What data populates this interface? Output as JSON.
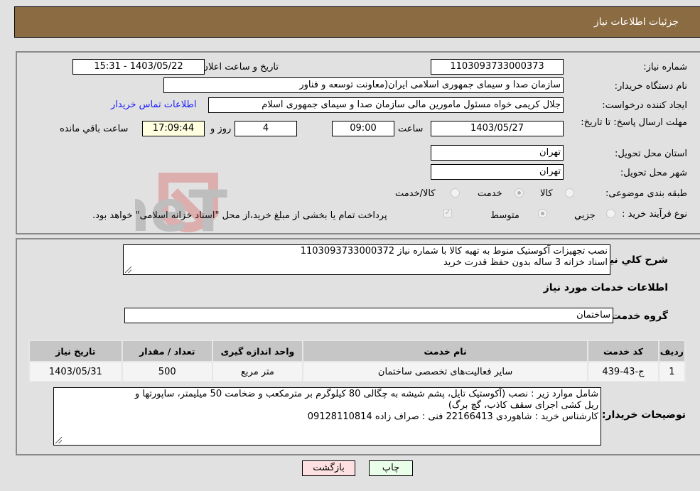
{
  "header": {
    "title": "جزئیات اطلاعات نیاز"
  },
  "form": {
    "need_number_label": "شماره نیاز:",
    "need_number": "1103093733000373",
    "announce_label": "تاریخ و ساعت اعلان عمومی:",
    "announce_value": "1403/05/22 - 15:31",
    "buyer_org_label": "نام دستگاه خریدار:",
    "buyer_org": "سازمان صدا و سیمای جمهوری اسلامی ایران(معاونت توسعه و فناور",
    "creator_label": "ایجاد کننده درخواست:",
    "creator": "جلال کریمی خواه مسئول مامورین مالی  سازمان صدا و سیمای جمهوری اسلام",
    "contact_link": "اطلاعات تماس خریدار",
    "deadline_label": "مهلت ارسال پاسخ: تا تاریخ:",
    "deadline_date": "1403/05/27",
    "time_label": "ساعت",
    "deadline_time": "09:00",
    "days_value": "4",
    "days_label": "روز و",
    "remaining_time": "17:09:44",
    "remaining_label": "ساعت باقي مانده",
    "province_label": "استان محل تحویل:",
    "province": "تهران",
    "city_label": "شهر محل تحویل:",
    "city": "تهران",
    "category_label": "طبقه بندی موضوعی:",
    "category_options": [
      {
        "label": "کالا",
        "checked": false
      },
      {
        "label": "خدمت",
        "checked": true
      },
      {
        "label": "کالا/خدمت",
        "checked": false
      }
    ],
    "process_label": "نوع فرآیند خرید :",
    "process_options": [
      {
        "label": "جزيي",
        "checked": false
      },
      {
        "label": "متوسط",
        "checked": true
      }
    ],
    "treasury_note": "پرداخت تمام یا بخشی از مبلغ خرید،از محل \"اسناد خزانه اسلامی\" خواهد بود.",
    "treasury_checked": true
  },
  "details": {
    "description_label": "شرح کلي نیاز:",
    "description_line1": "نصب تجهیزات آکوستیک  منوط به تهیه کالا با شماره نیاز 1103093733000372",
    "description_line2": "اسناد خزانه 3 ساله بدون حفظ قدرت خرید",
    "services_heading": "اطلاعات خدمات مورد نیاز",
    "service_group_label": "گروه خدمت:",
    "service_group": "ساختمان",
    "table": {
      "headers": [
        "ردیف",
        "کد خدمت",
        "نام خدمت",
        "واحد اندازه گیری",
        "تعداد / مقدار",
        "تاریخ نیاز"
      ],
      "rows": [
        [
          "1",
          "ج-43-439",
          "سایر فعالیت‌های تخصصی ساختمان",
          "متر مربع",
          "500",
          "1403/05/31"
        ]
      ]
    },
    "buyer_notes_label": "توضیحات خریدار:",
    "buyer_notes_line1": "شامل موارد زیر : نصب (آکوستیک تایل، پشم شیشه به چگالی 80 کیلوگرم بر مترمکعب و ضخامت 50 میلیمتر، ساپورتها و",
    "buyer_notes_line2": "ریل کشی اجرای سقف کاذب، گچ برگ)",
    "buyer_notes_line3": "کارشناس خرید : شاهوردی 22166413 فنی : صراف زاده 09128110814"
  },
  "buttons": {
    "print": "چاپ",
    "back": "بازگشت"
  },
  "watermark": {
    "text": "AriaTender.neT"
  }
}
